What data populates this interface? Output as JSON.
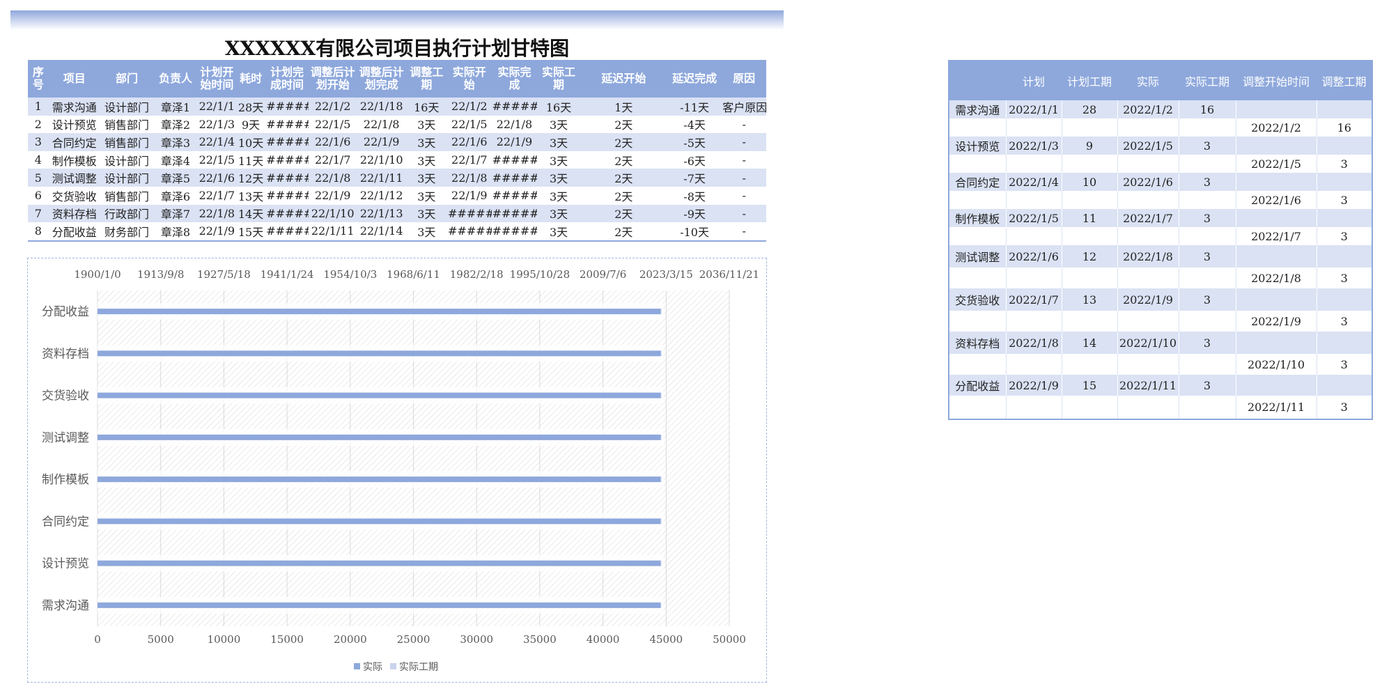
{
  "title": "XXXXXX有限公司项目执行计划甘特图",
  "plan_table": {
    "headers": [
      "序号",
      "项目",
      "部门",
      "负责人",
      "计划开始时间",
      "耗时",
      "计划完成时间",
      "调整后计划开始",
      "调整后计划完成",
      "调整工期",
      "实际开始",
      "实际完成",
      "实际工期",
      "延迟开始",
      "延迟完成",
      "原因"
    ],
    "rows": [
      [
        "1",
        "需求沟通",
        "设计部门",
        "章泽1",
        "22/1/1",
        "28天",
        "######",
        "22/1/2",
        "22/1/18",
        "16天",
        "22/1/2",
        "######",
        "16天",
        "1天",
        "-11天",
        "客户原因"
      ],
      [
        "2",
        "设计预览",
        "销售部门",
        "章泽2",
        "22/1/3",
        "9天",
        "######",
        "22/1/5",
        "22/1/8",
        "3天",
        "22/1/5",
        "22/1/8",
        "3天",
        "2天",
        "-4天",
        "-"
      ],
      [
        "3",
        "合同约定",
        "销售部门",
        "章泽3",
        "22/1/4",
        "10天",
        "######",
        "22/1/6",
        "22/1/9",
        "3天",
        "22/1/6",
        "22/1/9",
        "3天",
        "2天",
        "-5天",
        "-"
      ],
      [
        "4",
        "制作模板",
        "设计部门",
        "章泽4",
        "22/1/5",
        "11天",
        "######",
        "22/1/7",
        "22/1/10",
        "3天",
        "22/1/7",
        "######",
        "3天",
        "2天",
        "-6天",
        "-"
      ],
      [
        "5",
        "测试调整",
        "设计部门",
        "章泽5",
        "22/1/6",
        "12天",
        "######",
        "22/1/8",
        "22/1/11",
        "3天",
        "22/1/8",
        "######",
        "3天",
        "2天",
        "-7天",
        "-"
      ],
      [
        "6",
        "交货验收",
        "销售部门",
        "章泽6",
        "22/1/7",
        "13天",
        "######",
        "22/1/9",
        "22/1/12",
        "3天",
        "22/1/9",
        "######",
        "3天",
        "2天",
        "-8天",
        "-"
      ],
      [
        "7",
        "资料存档",
        "行政部门",
        "章泽7",
        "22/1/8",
        "14天",
        "######",
        "22/1/10",
        "22/1/13",
        "3天",
        "######",
        "######",
        "3天",
        "2天",
        "-9天",
        "-"
      ],
      [
        "8",
        "分配收益",
        "财务部门",
        "章泽8",
        "22/1/9",
        "15天",
        "######",
        "22/1/11",
        "22/1/14",
        "3天",
        "######",
        "######",
        "3天",
        "2天",
        "-10天",
        "-"
      ]
    ]
  },
  "side_table": {
    "headers": [
      "",
      "计划",
      "计划工期",
      "实际",
      "实际工期",
      "调整开始时间",
      "调整工期"
    ],
    "rows": [
      [
        "需求沟通",
        "2022/1/1",
        "28",
        "2022/1/2",
        "16",
        "",
        ""
      ],
      [
        "",
        "",
        "",
        "",
        "",
        "2022/1/2",
        "16"
      ],
      [
        "设计预览",
        "2022/1/3",
        "9",
        "2022/1/5",
        "3",
        "",
        ""
      ],
      [
        "",
        "",
        "",
        "",
        "",
        "2022/1/5",
        "3"
      ],
      [
        "合同约定",
        "2022/1/4",
        "10",
        "2022/1/6",
        "3",
        "",
        ""
      ],
      [
        "",
        "",
        "",
        "",
        "",
        "2022/1/6",
        "3"
      ],
      [
        "制作模板",
        "2022/1/5",
        "11",
        "2022/1/7",
        "3",
        "",
        ""
      ],
      [
        "",
        "",
        "",
        "",
        "",
        "2022/1/7",
        "3"
      ],
      [
        "测试调整",
        "2022/1/6",
        "12",
        "2022/1/8",
        "3",
        "",
        ""
      ],
      [
        "",
        "",
        "",
        "",
        "",
        "2022/1/8",
        "3"
      ],
      [
        "交货验收",
        "2022/1/7",
        "13",
        "2022/1/9",
        "3",
        "",
        ""
      ],
      [
        "",
        "",
        "",
        "",
        "",
        "2022/1/9",
        "3"
      ],
      [
        "资料存档",
        "2022/1/8",
        "14",
        "2022/1/10",
        "3",
        "",
        ""
      ],
      [
        "",
        "",
        "",
        "",
        "",
        "2022/1/10",
        "3"
      ],
      [
        "分配收益",
        "2022/1/9",
        "15",
        "2022/1/11",
        "3",
        "",
        ""
      ],
      [
        "",
        "",
        "",
        "",
        "",
        "2022/1/11",
        "3"
      ]
    ]
  },
  "chart_data": {
    "type": "bar",
    "orientation": "horizontal",
    "stacked": true,
    "categories": [
      "需求沟通",
      "设计预览",
      "合同约定",
      "制作模板",
      "测试调整",
      "交货验收",
      "资料存档",
      "分配收益"
    ],
    "series": [
      {
        "name": "实际",
        "values": [
          44563,
          44566,
          44567,
          44568,
          44569,
          44570,
          44571,
          44572
        ],
        "color": "#8ea8dc"
      },
      {
        "name": "实际工期",
        "values": [
          16,
          3,
          3,
          3,
          3,
          3,
          3,
          3
        ],
        "color": "#c9d4ee"
      }
    ],
    "x_bottom_ticks": [
      "0",
      "5000",
      "10000",
      "15000",
      "20000",
      "25000",
      "30000",
      "35000",
      "40000",
      "45000",
      "50000"
    ],
    "x_top_ticks": [
      "1900/1/0",
      "1913/9/8",
      "1927/5/18",
      "1941/1/24",
      "1954/10/3",
      "1968/6/11",
      "1982/2/18",
      "1995/10/28",
      "2009/7/6",
      "2023/3/15",
      "2036/11/21"
    ],
    "xlim": [
      0,
      50000
    ],
    "grid": true,
    "legend_position": "bottom"
  }
}
